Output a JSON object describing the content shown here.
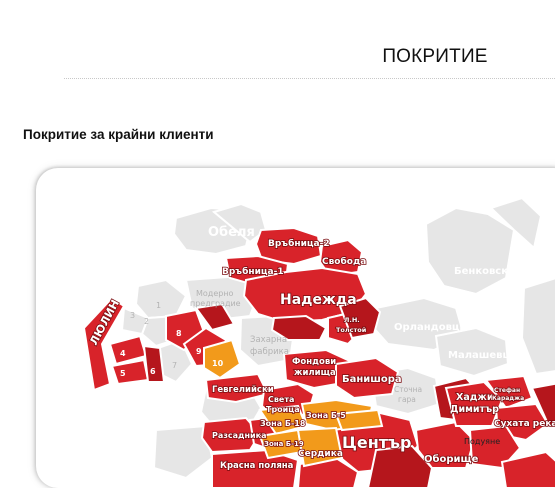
{
  "header": {
    "title": "ПОКРИТИЕ"
  },
  "section": {
    "heading": "Покритие за крайни клиенти"
  },
  "map": {
    "colors": {
      "covered": "#d8232a",
      "covered_dark": "#b5161c",
      "planned": "#f29a1b",
      "uncovered": "#e6e6e6"
    },
    "uncovered_labels": {
      "obelya": "Обеля",
      "benkovski": "Бенковски",
      "orlandovtsi": "Орландовци",
      "malashevtsi": "Малашевци",
      "moderno_line1": "Модерно",
      "moderno_line2": "предградие",
      "zaharna_line1": "Захарна",
      "zaharna_line2": "фабрика",
      "stochna_line1": "Сточна",
      "stochna_line2": "гара",
      "nadezhda_shadow": "Надежда",
      "zone_1": "1",
      "zone_2": "2",
      "zone_3": "3",
      "zone_7": "7"
    },
    "covered_labels": {
      "vrabnitsa2": "Връбница-2",
      "vrabnitsa1": "Връбница-1",
      "svoboda": "Свобода",
      "nadezhda": "Надежда",
      "tolstoy_line1": "Л.Н.",
      "tolstoy_line2": "Толстой",
      "lyulin": "ЛЮЛИН",
      "zone_4": "4",
      "zone_5": "5",
      "zone_6": "6",
      "zone_8": "8",
      "zone_9": "9",
      "zone_10": "10",
      "fondovi_line1": "Фондови",
      "fondovi_line2": "жилища",
      "banishora": "Банишора",
      "gevgeliyski": "Гевгелийски",
      "sveta_line1": "Света",
      "sveta_line2": "Троица",
      "zona_b5": "Зона Б-5",
      "zona_b18": "Зона Б-18",
      "zona_b19": "Зона Б-19",
      "razsadnika": "Разсадника",
      "serdika": "Сердика",
      "krasna_polyana": "Красна поляна",
      "tsentar": "Център",
      "oborishte": "Оборище",
      "hadzhi_line1": "Хаджи",
      "hadzhi_line2": "Димитър",
      "stefan_line1": "Стефан",
      "stefan_line2": "Караджа",
      "suhata_reka": "Сухата река",
      "podujane": "Подуяне"
    }
  }
}
